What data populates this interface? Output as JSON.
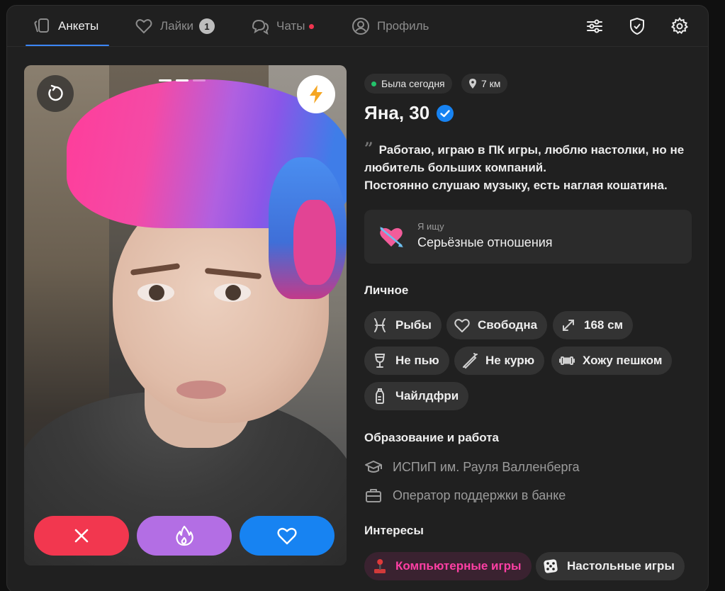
{
  "nav": {
    "tabs": [
      {
        "label": "Анкеты",
        "icon": "cards-icon"
      },
      {
        "label": "Лайки",
        "icon": "heart-icon",
        "badge": "1"
      },
      {
        "label": "Чаты",
        "icon": "chat-icon"
      },
      {
        "label": "Профиль",
        "icon": "user-icon"
      }
    ],
    "right_icons": [
      "filters-icon",
      "shield-icon",
      "gear-icon"
    ]
  },
  "photo": {
    "slides_total": 3,
    "slide_active": 2,
    "buttons": [
      "undo-icon",
      "lightning-icon",
      "close-icon",
      "fire-icon",
      "heart-icon"
    ]
  },
  "profile": {
    "status": "Была сегодня",
    "distance": "7 км",
    "name": "Яна, 30",
    "about_line1": "Работаю, играю в ПК игры, люблю настолки, но не любитель больших компаний.",
    "about_line2": "Постоянно слушаю музыку, есть наглая кошатина.",
    "seek_caption": "Я ищу",
    "seek_value": "Серьёзные отношения",
    "personal_title": "Личное",
    "personal": {
      "zodiac": "Рыбы",
      "relationship": "Свободна",
      "height": "168 см",
      "drinking": "Не пью",
      "smoking": "Не курю",
      "sport": "Хожу пешком",
      "kids": "Чайлдфри"
    },
    "edu_title": "Образование и работа",
    "education": "ИСПиП им. Рауля Валленберга",
    "job": "Оператор поддержки в банке",
    "interests_title": "Интересы",
    "interests": [
      "Компьютерные игры",
      "Настольные игры"
    ]
  },
  "colors": {
    "accent_blue": "#3b86f6",
    "dislike": "#f2374f",
    "super": "#b36ee4",
    "like": "#1783f2",
    "online": "#23c36b",
    "interest_pink": "#ff3fa4"
  }
}
